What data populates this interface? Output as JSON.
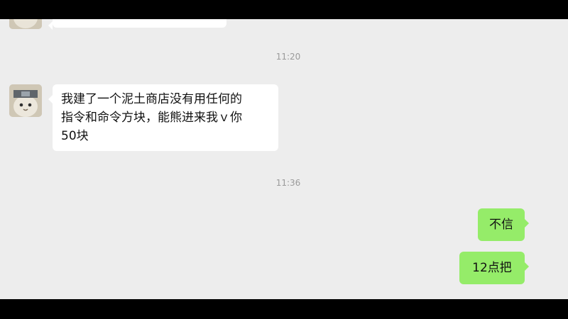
{
  "messages": [
    {
      "side": "left",
      "text_lines": [
        ""
      ]
    },
    {
      "side": "time",
      "text": "11:20"
    },
    {
      "side": "left",
      "text_lines": [
        "我建了一个泥土商店没有用任何的",
        "指令和命令方块，能熊进来我ｖ你",
        "50块"
      ]
    },
    {
      "side": "time",
      "text": "11:36"
    },
    {
      "side": "right",
      "text": "不信"
    },
    {
      "side": "right",
      "text": "12点把"
    }
  ],
  "colors": {
    "chat_background": "#ededed",
    "incoming_bubble": "#ffffff",
    "outgoing_bubble": "#95ec69",
    "letterbox": "#000000"
  },
  "icons": {
    "avatar": "cat-avatar-icon"
  }
}
